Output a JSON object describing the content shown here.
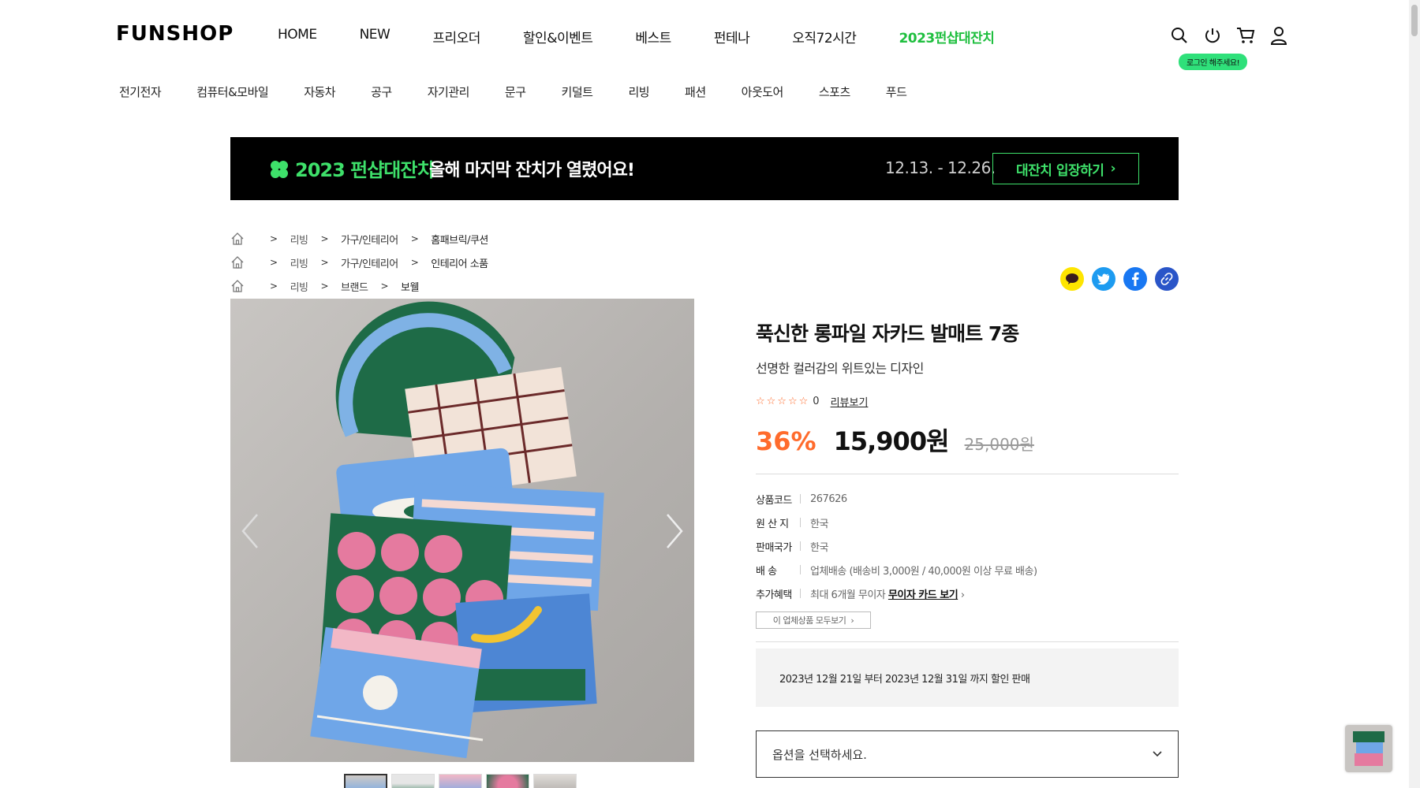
{
  "header": {
    "logo": "FUNSHOP",
    "nav": [
      "HOME",
      "NEW",
      "프리오더",
      "할인&이벤트",
      "베스트",
      "펀테나",
      "오직72시간",
      "2023펀샵대잔치"
    ],
    "login_tip": "로그인 해주세요!"
  },
  "categories": [
    "전기전자",
    "컴퓨터&모바일",
    "자동차",
    "공구",
    "자기관리",
    "문구",
    "키덜트",
    "리빙",
    "패션",
    "아웃도어",
    "스포츠",
    "푸드"
  ],
  "banner": {
    "title": "2023 펀샵대잔치",
    "subtitle": "올해 마지막 잔치가 열렸어요!",
    "date": "12.13. - 12.26.",
    "button": "대잔치 입장하기",
    "accent": "#3ee06a"
  },
  "breadcrumbs": [
    [
      "리빙",
      "가구/인테리어",
      "홈패브릭/쿠션"
    ],
    [
      "리빙",
      "가구/인테리어",
      "인테리어 소품"
    ],
    [
      "리빙",
      "브랜드",
      "보웰"
    ]
  ],
  "product": {
    "title": "푹신한 롱파일 자카드 발매트 7종",
    "subtitle": "선명한 컬러감의 위트있는 디자인",
    "rating_count": "0",
    "review_link": "리뷰보기",
    "discount": "36%",
    "price": "15,900원",
    "original_price": "25,000원",
    "specs": [
      {
        "k": "상품코드",
        "v": "267626"
      },
      {
        "k": "원 산 지",
        "v": "한국"
      },
      {
        "k": "판매국가",
        "v": "한국"
      },
      {
        "k": "배    송",
        "v": "업체배송 (배송비 3,000원 / 40,000원 이상 무료 배송)"
      },
      {
        "k": "추가혜택",
        "v": "최대 6개월 무이자",
        "link": "무이자 카드 보기"
      }
    ],
    "vendor_button": "이 업체상품 모두보기",
    "notice": "2023년 12월 21일 부터 2023년 12월 31일 까지 할인 판매",
    "option_placeholder": "옵션을 선택하세요.",
    "discount_color": "#ff6b2c"
  }
}
